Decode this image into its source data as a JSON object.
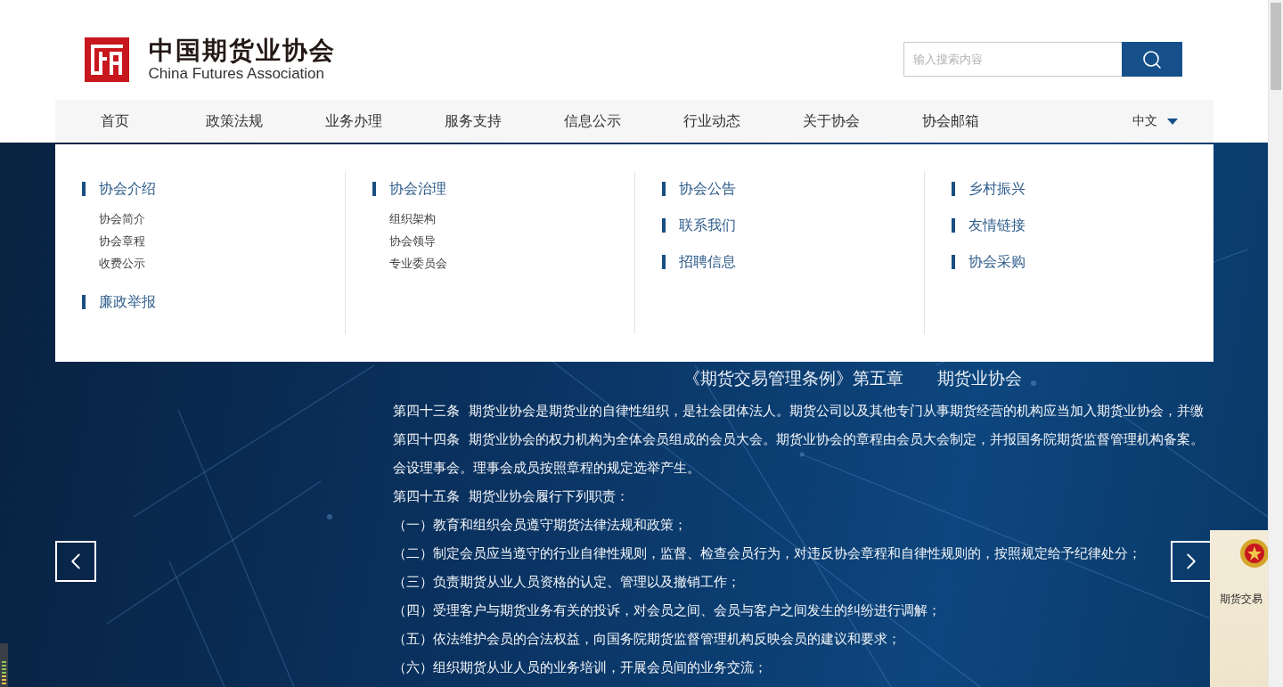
{
  "header": {
    "logo": {
      "title": "中国期货业协会",
      "subtitle": "China Futures Association"
    },
    "search": {
      "placeholder": "输入搜索内容"
    }
  },
  "nav": {
    "items": [
      {
        "label": "首页"
      },
      {
        "label": "政策法规"
      },
      {
        "label": "业务办理"
      },
      {
        "label": "服务支持"
      },
      {
        "label": "信息公示"
      },
      {
        "label": "行业动态"
      },
      {
        "label": "关于协会"
      },
      {
        "label": "协会邮箱"
      }
    ],
    "language": "中文"
  },
  "dropdown": {
    "columns": [
      {
        "groups": [
          {
            "label": "协会介绍",
            "children": [
              {
                "label": "协会简介"
              },
              {
                "label": "协会章程"
              },
              {
                "label": "收费公示"
              }
            ]
          },
          {
            "label": "廉政举报"
          }
        ]
      },
      {
        "groups": [
          {
            "label": "协会治理",
            "children": [
              {
                "label": "组织架构"
              },
              {
                "label": "协会领导"
              },
              {
                "label": "专业委员会"
              }
            ]
          }
        ]
      },
      {
        "groups": [
          {
            "label": "协会公告"
          },
          {
            "label": "联系我们"
          },
          {
            "label": "招聘信息"
          }
        ]
      },
      {
        "groups": [
          {
            "label": "乡村振兴"
          },
          {
            "label": "友情链接"
          },
          {
            "label": "协会采购"
          }
        ]
      }
    ]
  },
  "slide": {
    "heading": "《期货交易管理条例》第五章　　期货业协会",
    "lines": [
      "第四十三条  期货业协会是期货业的自律性组织，是社会团体法人。期货公司以及其他专门从事期货经营的机构应当加入期货业协会，并缴",
      "第四十四条  期货业协会的权力机构为全体会员组成的会员大会。期货业协会的章程由会员大会制定，并报国务院期货监督管理机构备案。",
      "会设理事会。理事会成员按照章程的规定选举产生。",
      "第四十五条  期货业协会履行下列职责：",
      "（一）教育和组织会员遵守期货法律法规和政策；",
      "（二）制定会员应当遵守的行业自律性规则，监督、检查会员行为，对违反协会章程和自律性规则的，按照规定给予纪律处分；",
      "（三）负责期货从业人员资格的认定、管理以及撤销工作；",
      "（四）受理客户与期货业务有关的投诉，对会员之间、会员与客户之间发生的纠纷进行调解；",
      "（五）依法维护会员的合法权益，向国务院期货监督管理机构反映会员的建议和要求；",
      "（六）组织期货从业人员的业务培训，开展会员间的业务交流；"
    ]
  },
  "side_card": {
    "text": "期货交易"
  }
}
